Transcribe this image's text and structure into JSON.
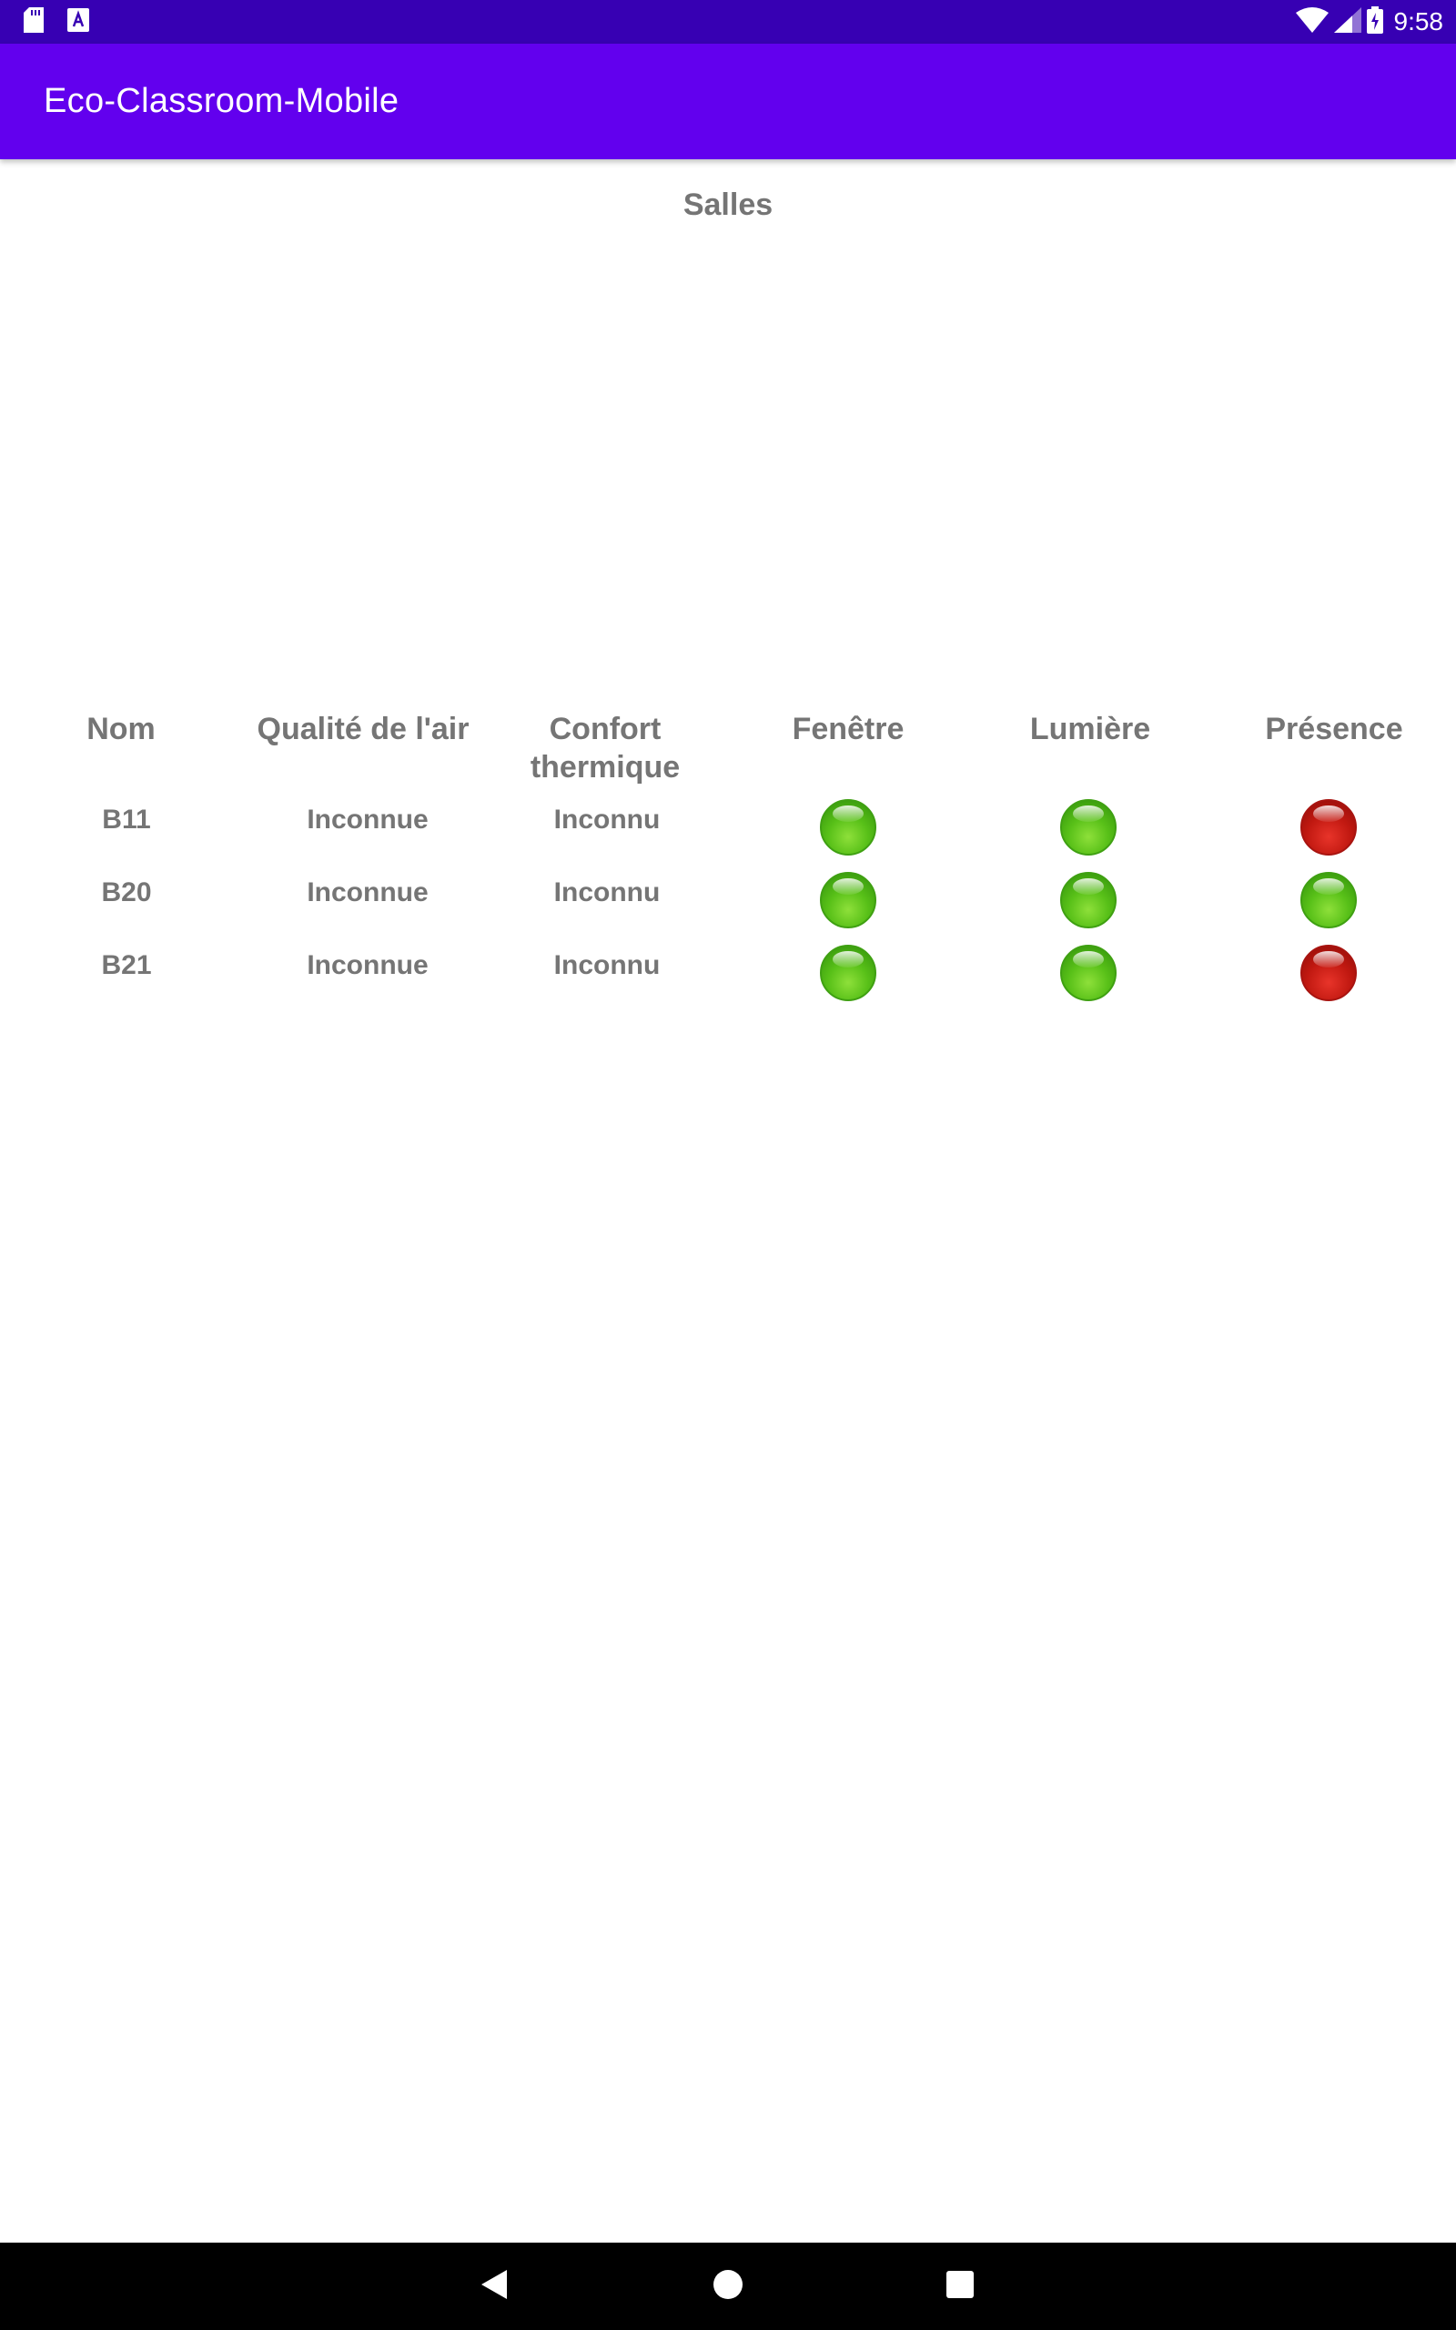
{
  "status_bar": {
    "time": "9:58",
    "icons": [
      "sd-card-icon",
      "notification-a-icon",
      "wifi-icon",
      "signal-icon",
      "battery-charging-icon"
    ]
  },
  "app_bar": {
    "title": "Eco-Classroom-Mobile"
  },
  "page": {
    "section_title": "Salles"
  },
  "table": {
    "headers": {
      "nom": "Nom",
      "air": "Qualité de l'air",
      "confort_line1": "Confort",
      "confort_line2": "thermique",
      "fenetre": "Fenêtre",
      "lumiere": "Lumière",
      "presence": "Présence"
    },
    "rows": [
      {
        "nom": "B11",
        "air": "Inconnue",
        "confort": "Inconnu",
        "fenetre": "green",
        "lumiere": "green",
        "presence": "red"
      },
      {
        "nom": "B20",
        "air": "Inconnue",
        "confort": "Inconnu",
        "fenetre": "green",
        "lumiere": "green",
        "presence": "green"
      },
      {
        "nom": "B21",
        "air": "Inconnue",
        "confort": "Inconnu",
        "fenetre": "green",
        "lumiere": "green",
        "presence": "red"
      }
    ]
  },
  "colors": {
    "status_bar": "#3700b3",
    "app_bar": "#6200ee",
    "text_gray": "#757575",
    "indicator_green": "#58c018",
    "indicator_red": "#c01810"
  },
  "nav_bar": {
    "buttons": [
      "back-icon",
      "home-icon",
      "recents-icon"
    ]
  }
}
